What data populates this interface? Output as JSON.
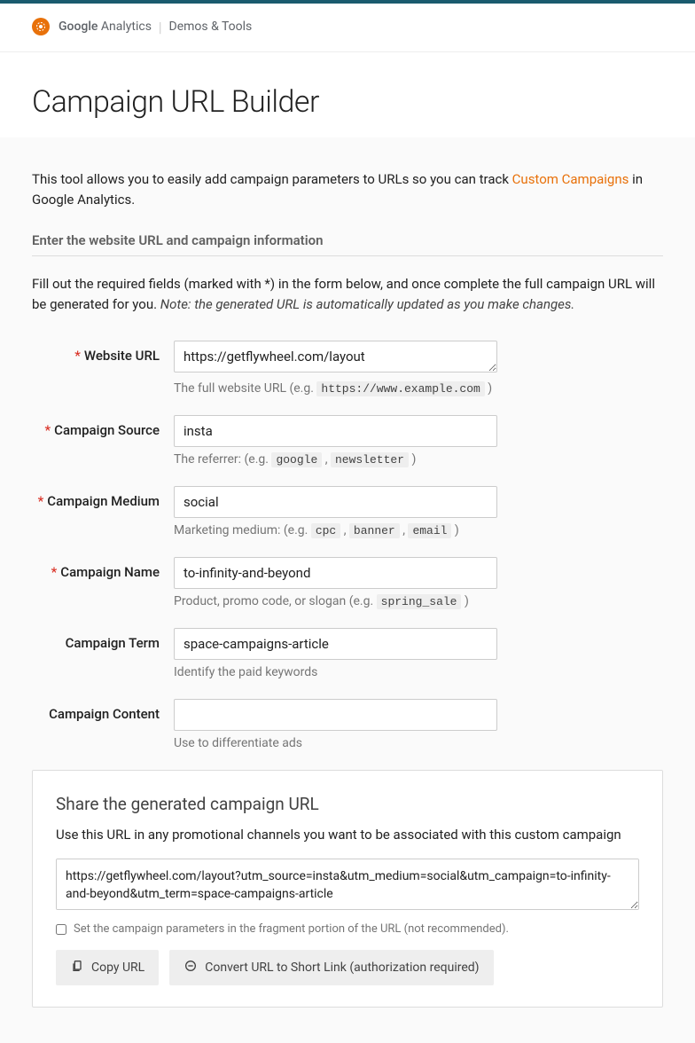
{
  "header": {
    "brand_strong": "Google",
    "brand_rest": " Analytics",
    "sub": "Demos & Tools"
  },
  "page": {
    "title": "Campaign URL Builder"
  },
  "intro": {
    "pre": "This tool allows you to easily add campaign parameters to URLs so you can track ",
    "link": "Custom Campaigns",
    "post": " in Google Analytics."
  },
  "section_header": "Enter the website URL and campaign information",
  "instructions": {
    "text": "Fill out the required fields (marked with *) in the form below, and once complete the full campaign URL will be generated for you. ",
    "note": "Note: the generated URL is automatically updated as you make changes."
  },
  "fields": {
    "website_url": {
      "label": "Website URL",
      "required": true,
      "value": "https://getflywheel.com/layout",
      "help_pre": "The full website URL (e.g. ",
      "help_code": "https://www.example.com",
      "help_post": " )"
    },
    "source": {
      "label": "Campaign Source",
      "required": true,
      "value": "insta",
      "help_pre": "The referrer: (e.g. ",
      "help_code1": "google",
      "help_sep": " , ",
      "help_code2": "newsletter",
      "help_post": " )"
    },
    "medium": {
      "label": "Campaign Medium",
      "required": true,
      "value": "social",
      "help_pre": "Marketing medium: (e.g. ",
      "help_code1": "cpc",
      "help_code2": "banner",
      "help_code3": "email",
      "help_sep": " , ",
      "help_post": " )"
    },
    "name": {
      "label": "Campaign Name",
      "required": true,
      "value": "to-infinity-and-beyond",
      "help_pre": "Product, promo code, or slogan (e.g. ",
      "help_code": "spring_sale",
      "help_post": " )"
    },
    "term": {
      "label": "Campaign Term",
      "required": false,
      "value": "space-campaigns-article",
      "help": "Identify the paid keywords"
    },
    "content": {
      "label": "Campaign Content",
      "required": false,
      "value": "",
      "help": "Use to differentiate ads"
    }
  },
  "share": {
    "title": "Share the generated campaign URL",
    "desc": "Use this URL in any promotional channels you want to be associated with this custom campaign",
    "generated_url": "https://getflywheel.com/layout?utm_source=insta&utm_medium=social&utm_campaign=to-infinity-and-beyond&utm_term=space-campaigns-article",
    "fragment_label": "Set the campaign parameters in the fragment portion of the URL (not recommended).",
    "copy_label": "Copy URL",
    "convert_label": "Convert URL to Short Link (authorization required)"
  }
}
